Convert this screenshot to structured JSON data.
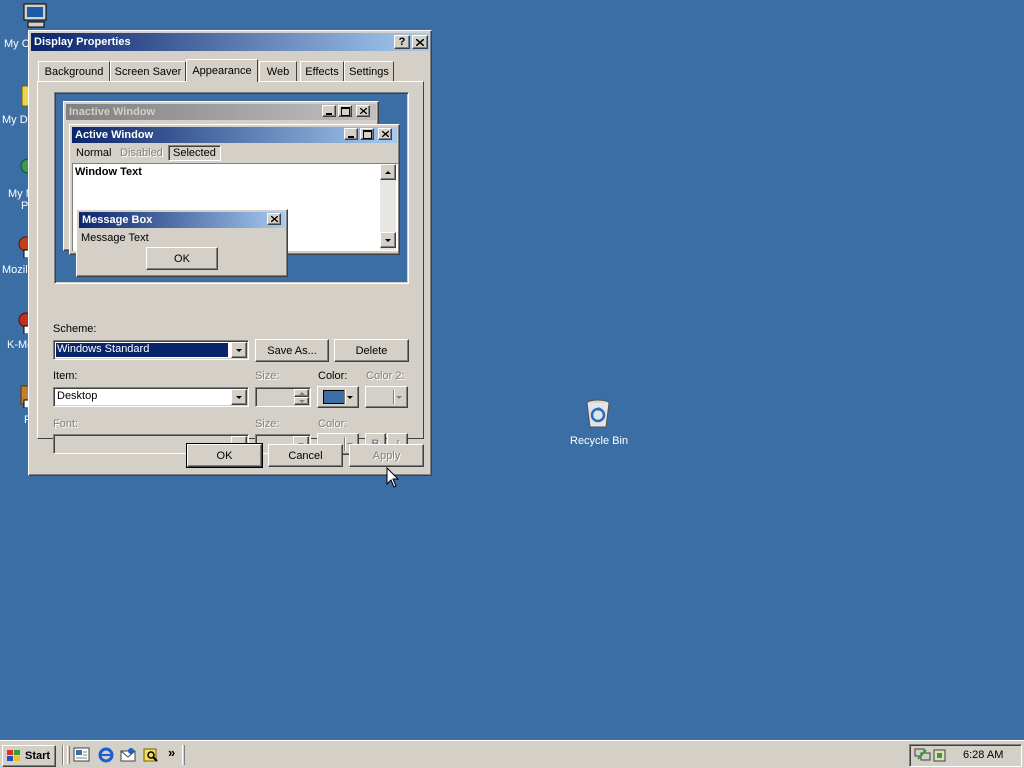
{
  "desktop": {
    "icons": [
      {
        "label": "My C"
      },
      {
        "label": "My Do"
      },
      {
        "label": "My N"
      },
      {
        "label": "P"
      },
      {
        "label": "Mozill"
      },
      {
        "label": "K-Me"
      },
      {
        "label": "R"
      }
    ],
    "recycle_bin_label": "Recycle Bin"
  },
  "dialog": {
    "title": "Display Properties",
    "help_glyph": "?",
    "tabs": [
      "Background",
      "Screen Saver",
      "Appearance",
      "Web",
      "Effects",
      "Settings"
    ],
    "selected_tab": "Appearance",
    "preview": {
      "inactive_title": "Inactive Window",
      "active_title": "Active Window",
      "menu": {
        "normal": "Normal",
        "disabled": "Disabled",
        "selected": "Selected"
      },
      "window_text": "Window Text",
      "message_box_title": "Message Box",
      "message_text": "Message Text",
      "ok": "OK"
    },
    "scheme_label": "Scheme:",
    "scheme_value": "Windows Standard",
    "save_as": "Save As...",
    "delete": "Delete",
    "item_label": "Item:",
    "item_value": "Desktop",
    "size_label": "Size:",
    "color_label": "Color:",
    "color2_label": "Color 2:",
    "font_label": "Font:",
    "font_size_label": "Size:",
    "font_color_label": "Color:",
    "bold_glyph": "B",
    "italic_glyph": "I",
    "selected_color": "#3a6ea5",
    "ok": "OK",
    "cancel": "Cancel",
    "apply": "Apply"
  },
  "taskbar": {
    "start": "Start",
    "chevron": "»",
    "clock": "6:28 AM"
  }
}
